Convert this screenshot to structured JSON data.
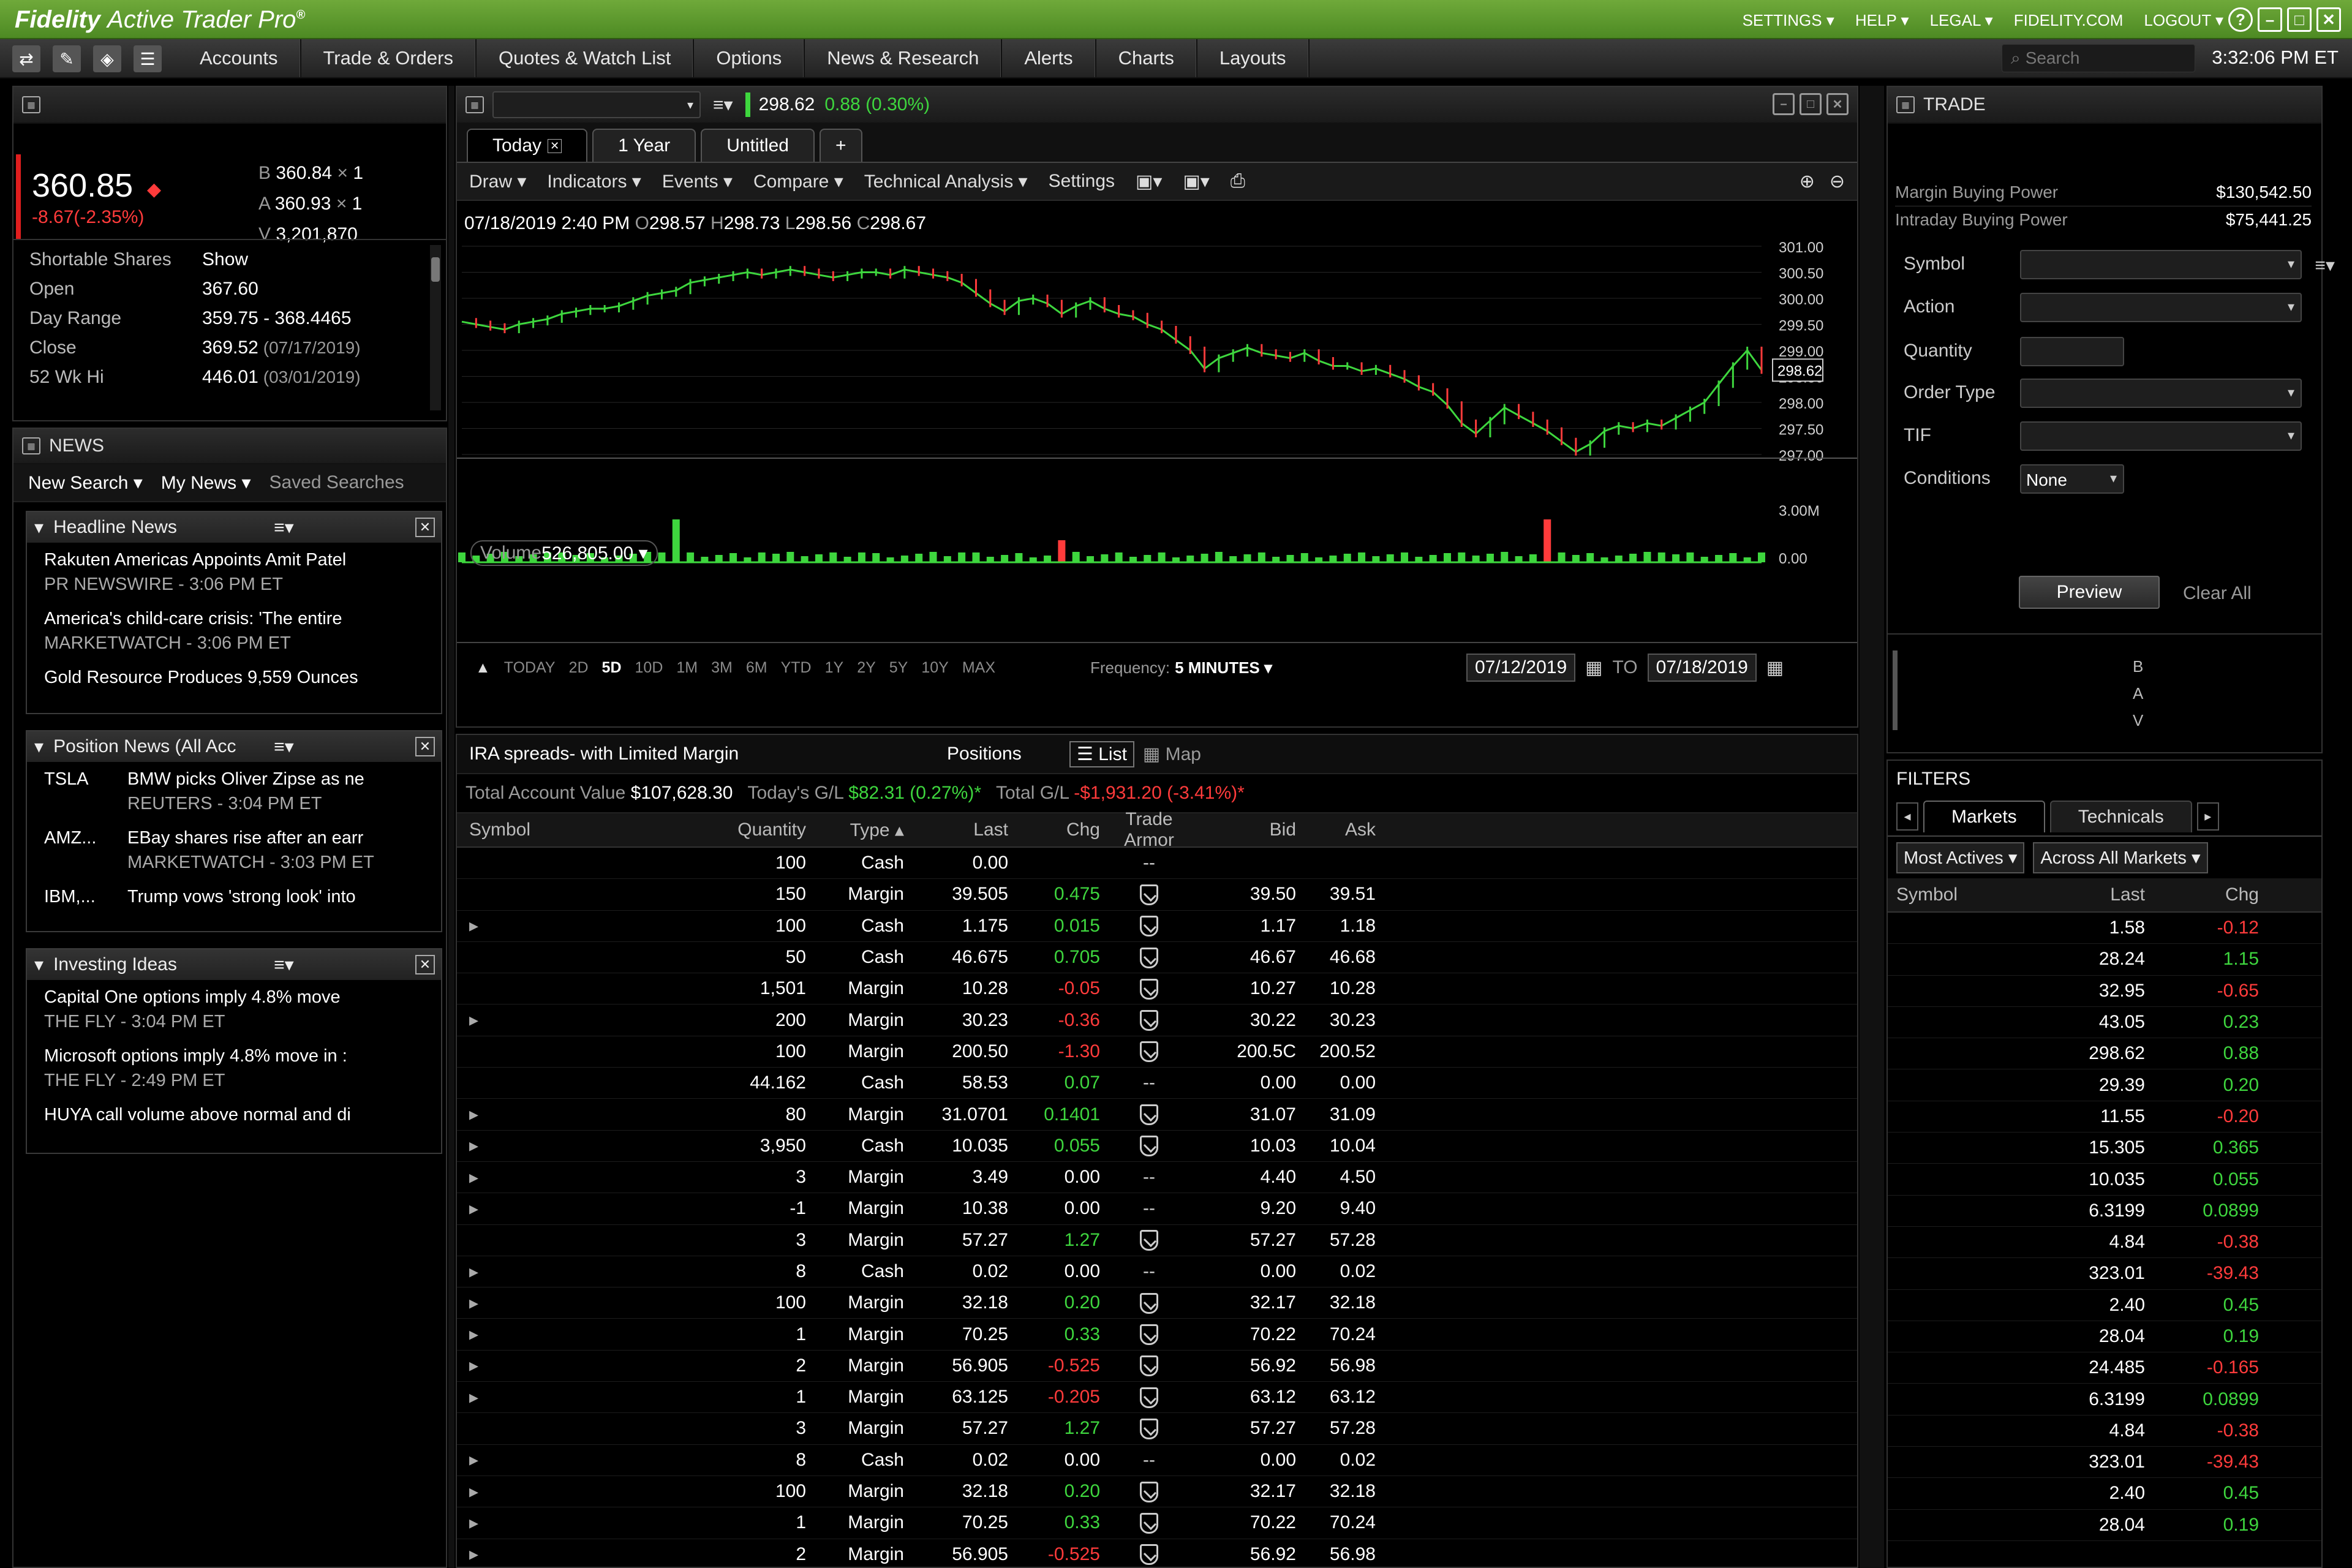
{
  "app": {
    "brand": "Fidelity",
    "product": "Active Trader Pro",
    "reg": "®"
  },
  "topmenu": [
    "SETTINGS ▾",
    "HELP ▾",
    "LEGAL ▾",
    "FIDELITY.COM",
    "LOGOUT ▾"
  ],
  "menus": [
    "Accounts",
    "Trade & Orders",
    "Quotes & Watch List",
    "Options",
    "News & Research",
    "Alerts",
    "Charts",
    "Layouts"
  ],
  "search_placeholder": "Search",
  "clock": "3:32:06 PM ET",
  "quote": {
    "price": "360.85",
    "change": "-8.67(-2.35%)",
    "bid": "360.84",
    "bid_size": "1",
    "ask": "360.93",
    "ask_size": "1",
    "volume": "3,201,870",
    "stats": [
      {
        "k": "Shortable Shares",
        "v": "Show",
        "note": ""
      },
      {
        "k": "Open",
        "v": "367.60",
        "note": ""
      },
      {
        "k": "Day Range",
        "v": "359.75 - 368.4465",
        "note": ""
      },
      {
        "k": "Close",
        "v": "369.52",
        "note": "(07/17/2019)"
      },
      {
        "k": "52 Wk Hi",
        "v": "446.01",
        "note": "(03/01/2019)"
      }
    ]
  },
  "news": {
    "title": "NEWS",
    "nav": [
      "New Search ▾",
      "My News ▾",
      "Saved Searches"
    ],
    "headline": {
      "title": "Headline News",
      "items": [
        {
          "h": "Rakuten Americas Appoints Amit Patel",
          "s": "PR NEWSWIRE - 3:06 PM ET"
        },
        {
          "h": "America's child-care crisis: 'The entire",
          "s": "MARKETWATCH - 3:06 PM ET"
        },
        {
          "h": "Gold Resource Produces 9,559 Ounces",
          "s": ""
        }
      ]
    },
    "position": {
      "title": "Position News (All Acc",
      "items": [
        {
          "sym": "TSLA",
          "h": "BMW picks Oliver Zipse as ne",
          "s": "REUTERS - 3:04 PM ET"
        },
        {
          "sym": "AMZ...",
          "h": "EBay shares rise after an earr",
          "s": "MARKETWATCH - 3:03 PM ET"
        },
        {
          "sym": "IBM,...",
          "h": "Trump vows 'strong look' into",
          "s": ""
        }
      ]
    },
    "ideas": {
      "title": "Investing Ideas",
      "items": [
        {
          "h": "Capital One options imply 4.8% move",
          "s": "THE FLY - 3:04 PM ET"
        },
        {
          "h": "Microsoft options imply 4.8% move in :",
          "s": "THE FLY - 2:49 PM ET"
        },
        {
          "h": "HUYA call volume above normal and di",
          "s": ""
        }
      ]
    }
  },
  "chart": {
    "price": "298.62",
    "change": "0.88 (0.30%)",
    "tabs": [
      "Today",
      "1 Year",
      "Untitled",
      "+"
    ],
    "tools": [
      "Draw ▾",
      "Indicators ▾",
      "Events ▾",
      "Compare ▾",
      "Technical Analysis ▾",
      "Settings"
    ],
    "ohlc": {
      "date": "07/18/2019 2:40 PM",
      "o": "298.57",
      "h": "298.73",
      "l": "298.56",
      "c": "298.67"
    },
    "volume_label": "Volume",
    "volume_value": "526,805.00 ▾",
    "ranges": [
      "TODAY",
      "2D",
      "5D",
      "10D",
      "1M",
      "3M",
      "6M",
      "YTD",
      "1Y",
      "2Y",
      "5Y",
      "10Y",
      "MAX"
    ],
    "active_range": "5D",
    "frequency_label": "Frequency:",
    "frequency_value": "5 MINUTES ▾",
    "from": "07/12/2019",
    "to_label": "TO",
    "to": "07/18/2019"
  },
  "chart_data": {
    "type": "line",
    "price_ticks": [
      "301.00",
      "300.50",
      "300.00",
      "299.50",
      "299.00",
      "298.50",
      "298.00",
      "297.50",
      "297.00"
    ],
    "last_marker": "298.62",
    "volume_ticks": [
      "3.00M",
      "0.00"
    ],
    "ylim": [
      297,
      301
    ],
    "price_series": [
      299.55,
      299.5,
      299.45,
      299.4,
      299.5,
      299.55,
      299.6,
      299.7,
      299.75,
      299.8,
      299.8,
      299.85,
      299.95,
      300.05,
      300.1,
      300.15,
      300.3,
      300.35,
      300.4,
      300.45,
      300.5,
      300.45,
      300.5,
      300.55,
      300.5,
      300.45,
      300.4,
      300.45,
      300.5,
      300.5,
      300.45,
      300.55,
      300.5,
      300.45,
      300.4,
      300.3,
      300.1,
      299.9,
      299.75,
      299.95,
      300.0,
      299.9,
      299.7,
      299.85,
      299.95,
      299.8,
      299.7,
      299.65,
      299.5,
      299.4,
      299.2,
      299.0,
      298.65,
      298.85,
      298.95,
      299.05,
      298.95,
      298.9,
      298.85,
      298.95,
      298.8,
      298.7,
      298.7,
      298.6,
      298.65,
      298.55,
      298.45,
      298.3,
      298.2,
      297.95,
      297.6,
      297.4,
      297.65,
      297.9,
      297.75,
      297.6,
      297.45,
      297.25,
      297.05,
      297.2,
      297.45,
      297.55,
      297.5,
      297.6,
      297.55,
      297.7,
      297.85,
      298.0,
      298.35,
      298.7,
      299.0,
      298.62
    ]
  },
  "positions": {
    "account": "IRA spreads- with Limited Margin",
    "label": "Positions",
    "view_list": "List",
    "view_map": "Map",
    "tav_label": "Total Account Value",
    "tav": "$107,628.30",
    "today_label": "Today's G/L",
    "today": "$82.31 (0.27%)*",
    "total_label": "Total G/L",
    "total": "-$1,931.20 (-3.41%)*",
    "headers": [
      "Symbol",
      "Quantity",
      "Type ▴",
      "Last",
      "Chg",
      "Trade Armor",
      "Bid",
      "Ask"
    ],
    "rows": [
      {
        "e": "",
        "q": "100",
        "t": "Cash",
        "l": "0.00",
        "c": "",
        "a": "--",
        "b": "",
        "k": ""
      },
      {
        "e": "",
        "q": "150",
        "t": "Margin",
        "l": "39.505",
        "c": "0.475",
        "a": "s",
        "b": "39.50",
        "k": "39.51"
      },
      {
        "e": "▸",
        "q": "100",
        "t": "Cash",
        "l": "1.175",
        "c": "0.015",
        "a": "s",
        "b": "1.17",
        "k": "1.18"
      },
      {
        "e": "",
        "q": "50",
        "t": "Cash",
        "l": "46.675",
        "c": "0.705",
        "a": "s",
        "b": "46.67",
        "k": "46.68"
      },
      {
        "e": "",
        "q": "1,501",
        "t": "Margin",
        "l": "10.28",
        "c": "-0.05",
        "a": "s",
        "b": "10.27",
        "k": "10.28"
      },
      {
        "e": "▸",
        "q": "200",
        "t": "Margin",
        "l": "30.23",
        "c": "-0.36",
        "a": "s",
        "b": "30.22",
        "k": "30.23"
      },
      {
        "e": "",
        "q": "100",
        "t": "Margin",
        "l": "200.50",
        "c": "-1.30",
        "a": "s",
        "b": "200.5C",
        "k": "200.52"
      },
      {
        "e": "",
        "q": "44.162",
        "t": "Cash",
        "l": "58.53",
        "c": "0.07",
        "a": "--",
        "b": "0.00",
        "k": "0.00"
      },
      {
        "e": "▸",
        "q": "80",
        "t": "Margin",
        "l": "31.0701",
        "c": "0.1401",
        "a": "s",
        "b": "31.07",
        "k": "31.09"
      },
      {
        "e": "▸",
        "q": "3,950",
        "t": "Cash",
        "l": "10.035",
        "c": "0.055",
        "a": "s",
        "b": "10.03",
        "k": "10.04"
      },
      {
        "e": "▸",
        "q": "3",
        "t": "Margin",
        "l": "3.49",
        "c": "0.00",
        "a": "--",
        "b": "4.40",
        "k": "4.50"
      },
      {
        "e": "▸",
        "q": "-1",
        "t": "Margin",
        "l": "10.38",
        "c": "0.00",
        "a": "--",
        "b": "9.20",
        "k": "9.40"
      },
      {
        "e": "",
        "q": "3",
        "t": "Margin",
        "l": "57.27",
        "c": "1.27",
        "a": "s",
        "b": "57.27",
        "k": "57.28"
      },
      {
        "e": "▸",
        "q": "8",
        "t": "Cash",
        "l": "0.02",
        "c": "0.00",
        "a": "--",
        "b": "0.00",
        "k": "0.02"
      },
      {
        "e": "▸",
        "q": "100",
        "t": "Margin",
        "l": "32.18",
        "c": "0.20",
        "a": "s",
        "b": "32.17",
        "k": "32.18"
      },
      {
        "e": "▸",
        "q": "1",
        "t": "Margin",
        "l": "70.25",
        "c": "0.33",
        "a": "s",
        "b": "70.22",
        "k": "70.24"
      },
      {
        "e": "▸",
        "q": "2",
        "t": "Margin",
        "l": "56.905",
        "c": "-0.525",
        "a": "s",
        "b": "56.92",
        "k": "56.98"
      },
      {
        "e": "▸",
        "q": "1",
        "t": "Margin",
        "l": "63.125",
        "c": "-0.205",
        "a": "s",
        "b": "63.12",
        "k": "63.12"
      },
      {
        "e": "",
        "q": "3",
        "t": "Margin",
        "l": "57.27",
        "c": "1.27",
        "a": "s",
        "b": "57.27",
        "k": "57.28"
      },
      {
        "e": "▸",
        "q": "8",
        "t": "Cash",
        "l": "0.02",
        "c": "0.00",
        "a": "--",
        "b": "0.00",
        "k": "0.02"
      },
      {
        "e": "▸",
        "q": "100",
        "t": "Margin",
        "l": "32.18",
        "c": "0.20",
        "a": "s",
        "b": "32.17",
        "k": "32.18"
      },
      {
        "e": "▸",
        "q": "1",
        "t": "Margin",
        "l": "70.25",
        "c": "0.33",
        "a": "s",
        "b": "70.22",
        "k": "70.24"
      },
      {
        "e": "▸",
        "q": "2",
        "t": "Margin",
        "l": "56.905",
        "c": "-0.525",
        "a": "s",
        "b": "56.92",
        "k": "56.98"
      }
    ]
  },
  "trade": {
    "title": "TRADE",
    "mbp_label": "Margin Buying Power",
    "mbp": "$130,542.50",
    "ibp_label": "Intraday Buying Power",
    "ibp": "$75,441.25",
    "fields": [
      "Symbol",
      "Action",
      "Quantity",
      "Order Type",
      "TIF",
      "Conditions"
    ],
    "conditions_value": "None",
    "preview": "Preview",
    "clear": "Clear All",
    "bav": [
      "B",
      "A",
      "V"
    ]
  },
  "filters": {
    "title": "FILTERS",
    "tabs": [
      "Markets",
      "Technicals"
    ],
    "sel1": "Most Actives ▾",
    "sel2": "Across All Markets ▾",
    "headers": [
      "Symbol",
      "Last",
      "Chg"
    ],
    "rows": [
      {
        "l": "1.58",
        "c": "-0.12"
      },
      {
        "l": "28.24",
        "c": "1.15"
      },
      {
        "l": "32.95",
        "c": "-0.65"
      },
      {
        "l": "43.05",
        "c": "0.23"
      },
      {
        "l": "298.62",
        "c": "0.88"
      },
      {
        "l": "29.39",
        "c": "0.20"
      },
      {
        "l": "11.55",
        "c": "-0.20"
      },
      {
        "l": "15.305",
        "c": "0.365"
      },
      {
        "l": "10.035",
        "c": "0.055"
      },
      {
        "l": "6.3199",
        "c": "0.0899"
      },
      {
        "l": "4.84",
        "c": "-0.38"
      },
      {
        "l": "323.01",
        "c": "-39.43"
      },
      {
        "l": "2.40",
        "c": "0.45"
      },
      {
        "l": "28.04",
        "c": "0.19"
      },
      {
        "l": "24.485",
        "c": "-0.165"
      },
      {
        "l": "6.3199",
        "c": "0.0899"
      },
      {
        "l": "4.84",
        "c": "-0.38"
      },
      {
        "l": "323.01",
        "c": "-39.43"
      },
      {
        "l": "2.40",
        "c": "0.45"
      },
      {
        "l": "28.04",
        "c": "0.19"
      }
    ]
  },
  "colors": {
    "up": "#3ed63e",
    "down": "#ff3b3b",
    "brand": "#5c9a2e"
  }
}
